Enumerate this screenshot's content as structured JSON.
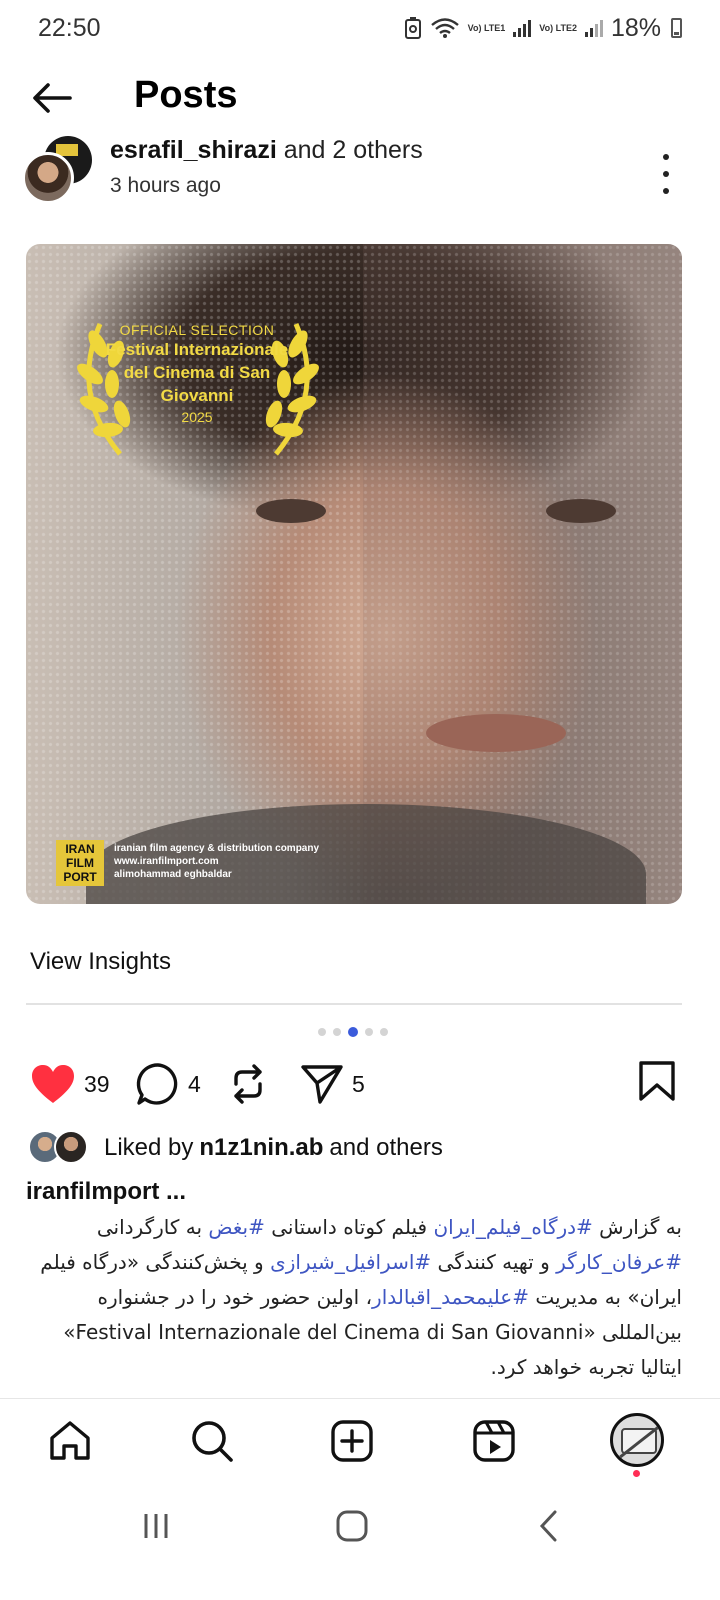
{
  "status_bar": {
    "time": "22:50",
    "network1": "Vo) LTE1",
    "network2": "Vo) LTE2",
    "battery": "18%"
  },
  "header": {
    "title": "Posts",
    "back_icon": "arrow-left-icon"
  },
  "post": {
    "users_primary": "esrafil_shirazi",
    "users_suffix": "and 2 others",
    "time_ago": "3 hours ago",
    "image_text": {
      "selection": "OFFICIAL SELECTION",
      "festival_line1": "Festival Internazionale",
      "festival_line2": "del Cinema di San",
      "festival_line3": "Giovanni",
      "year": "2025",
      "logo_line1": "IRAN",
      "logo_line2": "FILM",
      "logo_line3": "PORT",
      "agency_line1": "iranian film agency & distribution company",
      "agency_line2": "www.iranfilmport.com",
      "agency_line3": "alimohammad eghbaldar"
    },
    "insights_label": "View Insights",
    "carousel": {
      "count": 5,
      "active": 3
    },
    "actions": {
      "likes": "39",
      "comments": "4",
      "reposts_icon": "repost-icon",
      "shares": "5"
    },
    "liked_by": {
      "prefix": "Liked by",
      "user": "n1z1nin.ab",
      "suffix": "and others"
    },
    "caption_user": "iranfilmport ...",
    "caption": {
      "p1": "به گزارش ",
      "t1": "#درگاه_فیلم_ایران",
      "p2": " فیلم کوتاه داستانی ",
      "t2": "#بغض",
      "p3": " به کارگردانی ",
      "t3": "#عرفان_کارگر",
      "p4": " و تهیه کنندگی ",
      "t4": "#اسرافیل_شیرازی",
      "p5": " و پخش‌کنندگی «درگاه فیلم ایران» به مدیریت ",
      "t5": "#علیمحمد_اقبالدار",
      "p6": "، اولین حضور خود را در جشنواره بین‌المللی «Festival Internazionale del Cinema di San Giovanni» ایتالیا تجربه خواهد کرد."
    }
  },
  "colors": {
    "accent": "#3b5bdb",
    "like": "#ff3040",
    "hashtag": "#3e55c2",
    "laurel": "#f2da45"
  },
  "bottom_nav": {
    "home_icon": "home-icon",
    "search_icon": "search-icon",
    "create_icon": "plus-square-icon",
    "reels_icon": "reels-icon",
    "profile_icon": "profile-avatar"
  }
}
